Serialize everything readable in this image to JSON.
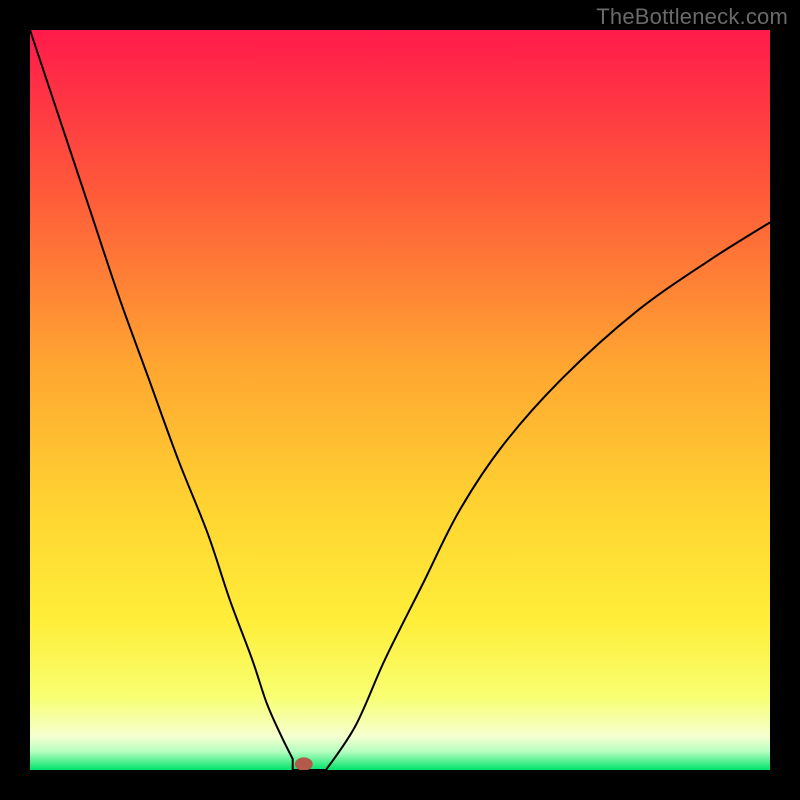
{
  "watermark": "TheBottleneck.com",
  "chart_data": {
    "type": "line",
    "title": "",
    "xlabel": "",
    "ylabel": "",
    "xlim": [
      0,
      100
    ],
    "ylim": [
      0,
      100
    ],
    "axes_visible": false,
    "grid": false,
    "background_gradient": [
      {
        "offset": 0.0,
        "color": "#ff1a4b"
      },
      {
        "offset": 0.22,
        "color": "#ff5a3a"
      },
      {
        "offset": 0.45,
        "color": "#ffa531"
      },
      {
        "offset": 0.65,
        "color": "#ffd531"
      },
      {
        "offset": 0.8,
        "color": "#ffee3a"
      },
      {
        "offset": 0.9,
        "color": "#f8ff70"
      },
      {
        "offset": 0.955,
        "color": "#f5ffd0"
      },
      {
        "offset": 0.975,
        "color": "#b5ffc0"
      },
      {
        "offset": 1.0,
        "color": "#00e36a"
      }
    ],
    "series": [
      {
        "name": "bottleneck-curve",
        "color": "#000000",
        "width": 2,
        "x": [
          0,
          4,
          8,
          12,
          16,
          20,
          24,
          27,
          30,
          32,
          34,
          35.5,
          37,
          40,
          44,
          48,
          53,
          58,
          64,
          72,
          82,
          92,
          100
        ],
        "y": [
          100,
          88,
          76,
          64,
          53,
          42,
          32,
          23,
          15,
          9,
          4.5,
          1.5,
          0,
          0,
          6,
          15,
          25,
          35,
          44,
          53,
          62,
          69,
          74
        ]
      }
    ],
    "marker": {
      "name": "selected-point",
      "x": 37,
      "y": 0.8,
      "rx": 1.2,
      "ry": 0.9,
      "color": "#b35a4a"
    },
    "floor_segment": {
      "x0": 35.5,
      "x1": 40,
      "y": 0
    }
  }
}
